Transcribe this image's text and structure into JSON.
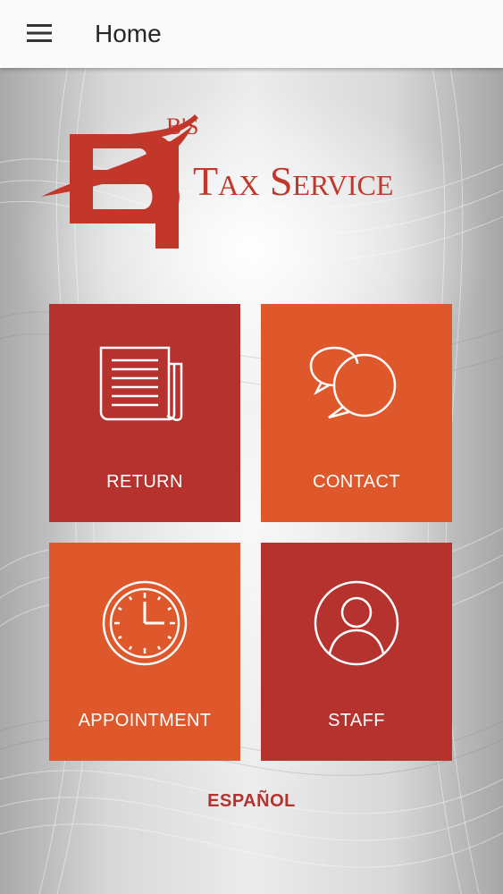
{
  "app_bar": {
    "title": "Home",
    "menu_icon": "hamburger-menu-icon"
  },
  "logo": {
    "mark": "B'S",
    "text": "Tax Service"
  },
  "tiles": [
    {
      "label": "RETURN",
      "icon": "newspaper-icon",
      "color": "#b5322f"
    },
    {
      "label": "CONTACT",
      "icon": "chat-bubbles-icon",
      "color": "#df582b"
    },
    {
      "label": "APPOINTMENT",
      "icon": "clock-icon",
      "color": "#df582b"
    },
    {
      "label": "STAFF",
      "icon": "user-avatar-icon",
      "color": "#b5322f"
    }
  ],
  "language_link": "ESPAÑOL",
  "colors": {
    "brand_red": "#b5322f",
    "brand_orange": "#df582b",
    "app_bar": "#fafafa"
  }
}
